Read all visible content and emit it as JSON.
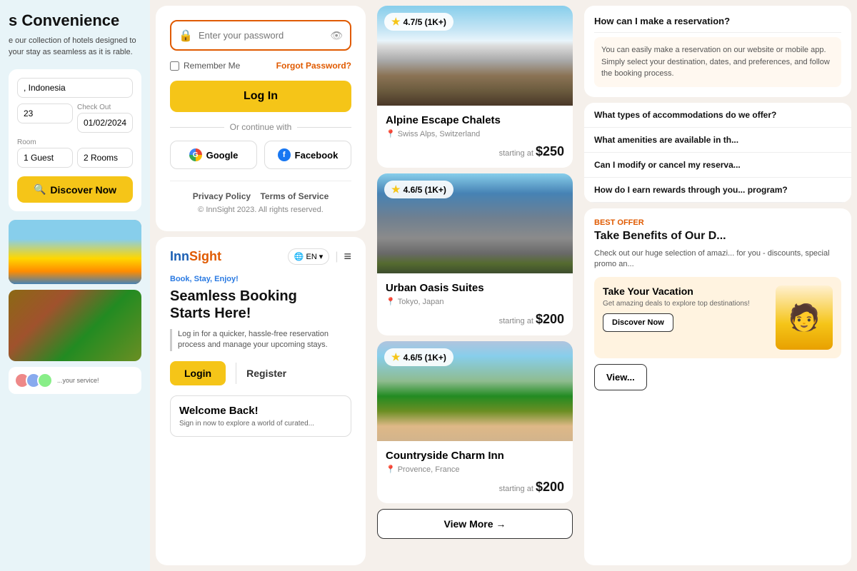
{
  "col1": {
    "title": "s Convenience",
    "desc": "e our collection of hotels designed to your stay as seamless as it is rable.",
    "location_placeholder": ", Indonesia",
    "checkout_label": "Check Out",
    "checkout_date": "01/02/2024",
    "checkin_date": "23",
    "rooms_label": "Room",
    "rooms_value": "2 Rooms",
    "discover_btn": "Discover Now"
  },
  "col2": {
    "login": {
      "password_placeholder": "Enter your password",
      "remember_label": "Remember Me",
      "forgot_label": "Forgot Password?",
      "login_btn": "Log In",
      "or_text": "Or continue with",
      "google_btn": "Google",
      "facebook_btn": "Facebook",
      "privacy_label": "Privacy Policy",
      "terms_label": "Terms of Service",
      "copyright": "© InnSight 2023. All rights reserved."
    },
    "innsight": {
      "logo_part1": "Inn",
      "logo_part2": "Sight",
      "lang": "EN",
      "tagline": "Book, Stay, Enjoy!",
      "heading_line1": "Seamless Booking",
      "heading_line2": "Starts Here!",
      "sub": "Log in for a quicker, hassle-free reservation process and manage your upcoming stays.",
      "login_btn": "Login",
      "register_btn": "Register",
      "welcome_title": "Welcome Back!",
      "welcome_sub": "Sign in now to explore a world of curated..."
    }
  },
  "col3": {
    "hotels": [
      {
        "name": "Alpine Escape Chalets",
        "location": "Swiss Alps, Switzerland",
        "rating": "4.7/5 (1K+)",
        "price_label": "starting at",
        "price": "$250"
      },
      {
        "name": "Urban Oasis Suites",
        "location": "Tokyo, Japan",
        "rating": "4.6/5 (1K+)",
        "price_label": "starting at",
        "price": "$200"
      },
      {
        "name": "Countryside Charm Inn",
        "location": "Provence, France",
        "rating": "4.6/5 (1K+)",
        "price_label": "starting at",
        "price": "$200"
      }
    ],
    "view_more_btn": "View More →"
  },
  "col4": {
    "faq_title": "How can I make a reservation?",
    "faq_answer": "You can easily make a reservation on our website or mobile app. Simply select your destination, dates, and preferences, and follow the booking process.",
    "faq_items": [
      "What types of accommodations do we offer?",
      "What amenities are available in th...",
      "Can I modify or cancel my reserva...",
      "How do I earn rewards through you... program?"
    ],
    "best_offer_label": "BEST OFFER",
    "best_offer_title": "Take Benefits of Our D...",
    "best_offer_desc": "Check out our huge selection of amazi... for you - discounts, special promo an...",
    "offer_card_title": "Take Your Vacation",
    "offer_card_sub": "Get amazing deals to explore top destinations!",
    "offer_discover_btn": "Discover Now",
    "view_more_btn": "View..."
  }
}
